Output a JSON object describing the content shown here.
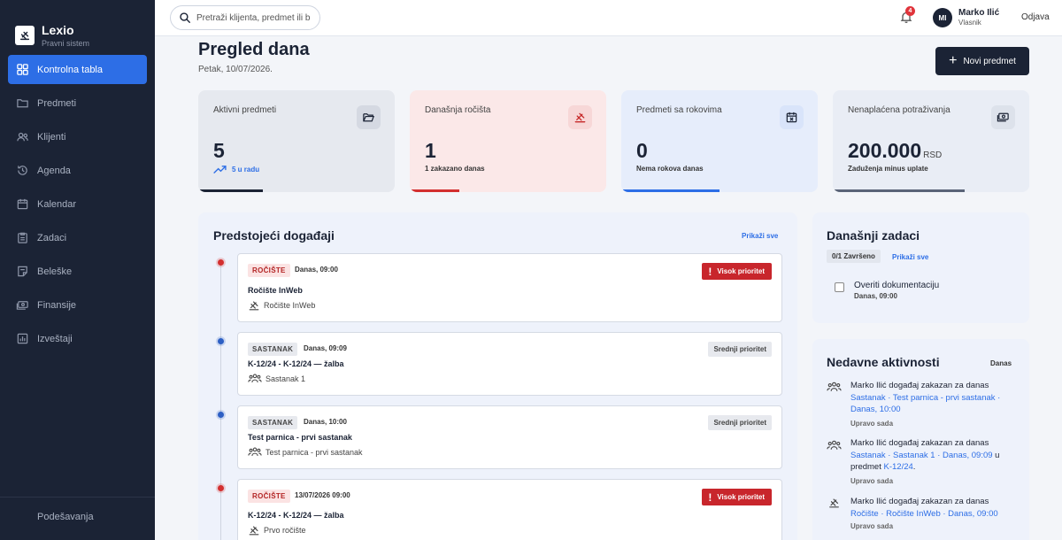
{
  "brand": {
    "name": "Lexio",
    "subtitle": "Pravni sistem"
  },
  "sidebar": {
    "items": [
      {
        "label": "Kontrolna tabla",
        "icon": "dashboard-icon",
        "active": true
      },
      {
        "label": "Predmeti",
        "icon": "folder-icon"
      },
      {
        "label": "Klijenti",
        "icon": "users-icon"
      },
      {
        "label": "Agenda",
        "icon": "history-icon"
      },
      {
        "label": "Kalendar",
        "icon": "calendar-icon"
      },
      {
        "label": "Zadaci",
        "icon": "clipboard-icon"
      },
      {
        "label": "Beleške",
        "icon": "note-icon"
      },
      {
        "label": "Finansije",
        "icon": "cash-icon"
      },
      {
        "label": "Izveštaji",
        "icon": "chart-icon"
      }
    ],
    "settings_label": "Podešavanja"
  },
  "topbar": {
    "search_placeholder": "Pretraži klijenta, predmet ili b",
    "notification_count": "4",
    "avatar_initials": "MI",
    "user_name": "Marko Ilić",
    "user_role": "Vlasnik",
    "logout_label": "Odjava"
  },
  "header": {
    "title": "Pregled dana",
    "date": "Petak, 10/07/2026.",
    "new_button_label": "Novi predmet"
  },
  "stats": [
    {
      "label": "Aktivni predmeti",
      "value": "5",
      "unit": "",
      "sub": "5 u radu",
      "icon": "folder-open-icon",
      "bg": "#e6e9ef",
      "bar_color": "#1b2335",
      "progress": 0.33
    },
    {
      "label": "Današnja ročišta",
      "value": "1",
      "unit": "",
      "sub": "1 zakazano danas",
      "icon": "gavel-icon",
      "bg": "#fbe8e8",
      "bar_color": "#d32f2f",
      "progress": 0.25
    },
    {
      "label": "Predmeti sa rokovima",
      "value": "0",
      "unit": "",
      "sub": "Nema rokova danas",
      "icon": "calendar-x-icon",
      "bg": "#e6edfb",
      "bar_color": "#2d6ee6",
      "progress": 0.5
    },
    {
      "label": "Nenaplaćena potraživanja",
      "value": "200.000",
      "unit": "RSD",
      "sub": "Zaduženja minus uplate",
      "icon": "money-icon",
      "bg": "#e9edf5",
      "bar_color": "#5a6478",
      "progress": 0.67
    }
  ],
  "events_panel": {
    "title": "Predstojeći događaji",
    "show_all": "Prikaži sve",
    "events": [
      {
        "type": "ROČIŠTE",
        "time": "Danas, 09:00",
        "priority": "Visok prioritet",
        "title": "Ročište InWeb",
        "subtitle": "Ročište InWeb",
        "dot_color": "#d32f2f"
      },
      {
        "type": "SASTANAK",
        "time": "Danas, 09:09",
        "priority": "Srednji prioritet",
        "title": "K-12/24 - K-12/24 — žalba",
        "subtitle": "Sastanak 1",
        "dot_color": "#2d5fc4"
      },
      {
        "type": "SASTANAK",
        "time": "Danas, 10:00",
        "priority": "Srednji prioritet",
        "title": "Test parnica - prvi sastanak",
        "subtitle": "Test parnica - prvi sastanak",
        "dot_color": "#2d5fc4"
      },
      {
        "type": "ROČIŠTE",
        "time": "13/07/2026 09:00",
        "priority": "Visok prioritet",
        "title": "K-12/24 - K-12/24 — žalba",
        "subtitle": "Prvo ročište",
        "dot_color": "#d32f2f"
      }
    ]
  },
  "tasks_panel": {
    "title": "Današnji zadaci",
    "progress_label": "0/1 Završeno",
    "show_all": "Prikaži sve",
    "tasks": [
      {
        "title": "Overiti dokumentaciju",
        "time": "Danas, 09:00",
        "done": false
      }
    ]
  },
  "activity_panel": {
    "title": "Nedavne aktivnosti",
    "filter": "Danas",
    "items": [
      {
        "actor": "Marko Ilić",
        "action": "događaj zakazan za danas",
        "detail": "Sastanak · Test parnica - prvi sastanak · Danas, 10:00",
        "suffix": "",
        "case": "",
        "time": "Upravo sada",
        "icon": "users-icon"
      },
      {
        "actor": "Marko Ilić",
        "action": "događaj zakazan za danas",
        "detail": "Sastanak · Sastanak 1 · Danas, 09:09",
        "suffix": " u predmet ",
        "case": "K-12/24",
        "time": "Upravo sada",
        "icon": "users-icon"
      },
      {
        "actor": "Marko Ilić",
        "action": "događaj zakazan za danas",
        "detail": "Ročište · Ročište InWeb · Danas, 09:00",
        "suffix": "",
        "case": "",
        "time": "Upravo sada",
        "icon": "gavel-icon"
      }
    ]
  }
}
